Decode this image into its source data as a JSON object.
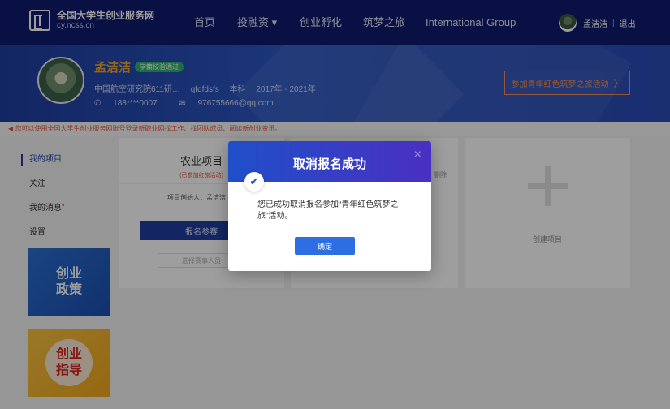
{
  "site": {
    "title": "全国大学生创业服务网",
    "domain": "cy.ncss.cn"
  },
  "nav": {
    "items": [
      "首页",
      "投融资 ▾",
      "创业孵化",
      "筑梦之旅",
      "International Group"
    ],
    "user_name": "孟洁洁",
    "logout": "退出",
    "separator": "|"
  },
  "profile": {
    "name": "孟洁洁",
    "badge": "学籍校验通过",
    "school": "中国航空研究院611研…",
    "major": "gfdfdsfs",
    "degree": "本科",
    "years": "2017年 - 2021年",
    "phone": "188****0007",
    "email": "976755666@qq.com",
    "join_button": "参加青年红色筑梦之旅活动",
    "join_chevron": "〉"
  },
  "notice": "您可以使用全国大学生创业服务网账号登录新职业网找工作、找团队成员、阅读新创业资讯。",
  "sidebar": {
    "items": [
      {
        "label": "我的项目",
        "active": true
      },
      {
        "label": "关注",
        "active": false
      },
      {
        "label": "我的消息",
        "active": false,
        "dot": "•"
      },
      {
        "label": "设置",
        "active": false
      }
    ],
    "promo1": "创业\n政策",
    "promo2": "创业\n指导"
  },
  "cards": {
    "project": {
      "title": "农业项目",
      "subtitle": "(已参加红旅活动)",
      "creator": "项目创始人：孟洁洁",
      "signup": "报名参赛",
      "select_members": "选择赛事人员"
    },
    "second": {
      "delete": "删除"
    },
    "create": {
      "label": "创建项目"
    }
  },
  "modal": {
    "title": "取消报名成功",
    "close": "×",
    "message": "您已成功取消报名参加“青年红色筑梦之旅”活动。",
    "confirm": "确定",
    "check_icon": "✔"
  }
}
